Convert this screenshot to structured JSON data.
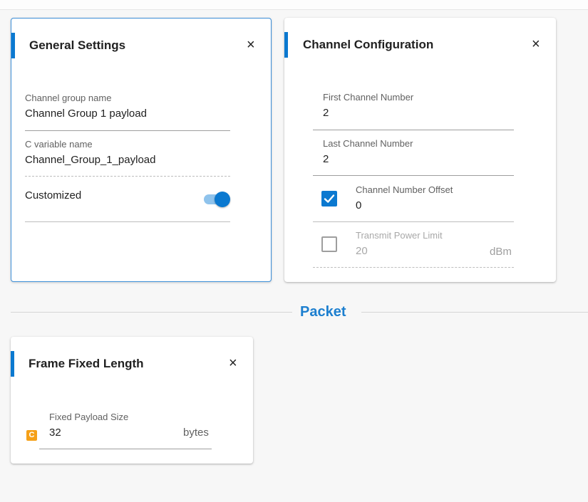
{
  "general_settings": {
    "title": "General Settings",
    "close_label": "×",
    "channel_group_name": {
      "label": "Channel group name",
      "value": "Channel Group 1 payload"
    },
    "c_variable_name": {
      "label": "C variable name",
      "value": "Channel_Group_1_payload"
    },
    "customized": {
      "label": "Customized",
      "checked": true
    }
  },
  "channel_configuration": {
    "title": "Channel Configuration",
    "close_label": "×",
    "first_channel_number": {
      "label": "First Channel Number",
      "value": "2"
    },
    "last_channel_number": {
      "label": "Last Channel Number",
      "value": "2"
    },
    "channel_number_offset": {
      "label": "Channel Number Offset",
      "value": "0",
      "checked": true
    },
    "transmit_power_limit": {
      "label": "Transmit Power Limit",
      "value": "20",
      "unit": "dBm",
      "checked": false
    }
  },
  "section": {
    "title": "Packet"
  },
  "frame_fixed_length": {
    "title": "Frame Fixed Length",
    "close_label": "×",
    "badge": "C",
    "fixed_payload_size": {
      "label": "Fixed Payload Size",
      "value": "32",
      "unit": "bytes"
    }
  },
  "colors": {
    "accent": "#0b79d0",
    "section_title": "#1d7fcf",
    "badge": "#f5a018",
    "selected_border": "#3d8fd8"
  }
}
